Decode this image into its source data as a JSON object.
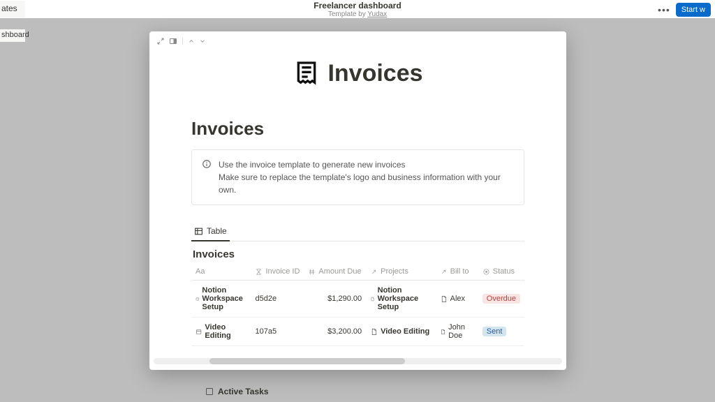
{
  "header": {
    "title": "Freelancer dashboard",
    "subtitle_prefix": "Template by ",
    "subtitle_link": "Yudax",
    "more": "•••",
    "start": "Start w"
  },
  "sidebar": {
    "frag1": "ates",
    "frag2": "shboard"
  },
  "popover": {
    "hero_title": "Invoices",
    "section_title": "Invoices",
    "callout": {
      "line1": "Use the invoice template to generate new invoices",
      "line2": "Make sure to replace the template's logo and business information with your own."
    },
    "tab": "Table",
    "db_title": "Invoices",
    "columns": {
      "name": "Aa",
      "invoice_id": "Invoice ID",
      "amount": "Amount Due",
      "projects": "Projects",
      "bill_to": "Bill to",
      "status": "Status"
    },
    "rows": [
      {
        "name": "Notion Workspace Setup",
        "invoice_id": "d5d2e",
        "amount": "$1,290.00",
        "project": "Notion Workspace Setup",
        "bill_to": "Alex",
        "status": "Overdue",
        "status_class": "pill-overdue"
      },
      {
        "name": "Video Editing",
        "invoice_id": "107a5",
        "amount": "$3,200.00",
        "project": "Video Editing",
        "bill_to": "John Doe",
        "status": "Sent",
        "status_class": "pill-sent"
      }
    ]
  },
  "background": {
    "active_tasks": "Active Tasks"
  }
}
